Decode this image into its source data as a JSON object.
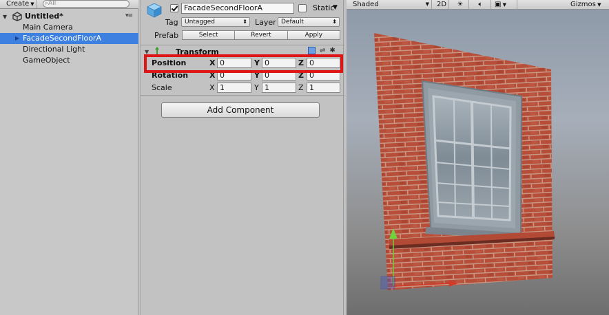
{
  "hierarchy": {
    "create_label": "Create",
    "search_placeholder": "All",
    "scene_name": "Untitled*",
    "items": [
      {
        "label": "Main Camera"
      },
      {
        "label": "FacadeSecondFloorA"
      },
      {
        "label": "Directional Light"
      },
      {
        "label": "GameObject"
      }
    ]
  },
  "inspector": {
    "object_name": "FacadeSecondFloorA",
    "active": true,
    "static_label": "Static",
    "static_checked": false,
    "tag_label": "Tag",
    "tag_value": "Untagged",
    "layer_label": "Layer",
    "layer_value": "Default",
    "prefab_label": "Prefab",
    "prefab_select": "Select",
    "prefab_revert": "Revert",
    "prefab_apply": "Apply",
    "transform": {
      "title": "Transform",
      "rows": [
        {
          "label": "Position",
          "x": "0",
          "y": "0",
          "z": "0"
        },
        {
          "label": "Rotation",
          "x": "0",
          "y": "0",
          "z": "0"
        },
        {
          "label": "Scale",
          "x": "1",
          "y": "1",
          "z": "1"
        }
      ],
      "axis_x": "X",
      "axis_y": "Y",
      "axis_z": "Z"
    },
    "add_component_label": "Add Component"
  },
  "scene": {
    "shading_mode": "Shaded",
    "mode_2d": "2D",
    "gizmos_label": "Gizmos"
  },
  "colors": {
    "selection": "#3d80df",
    "highlight": "#e01515"
  }
}
